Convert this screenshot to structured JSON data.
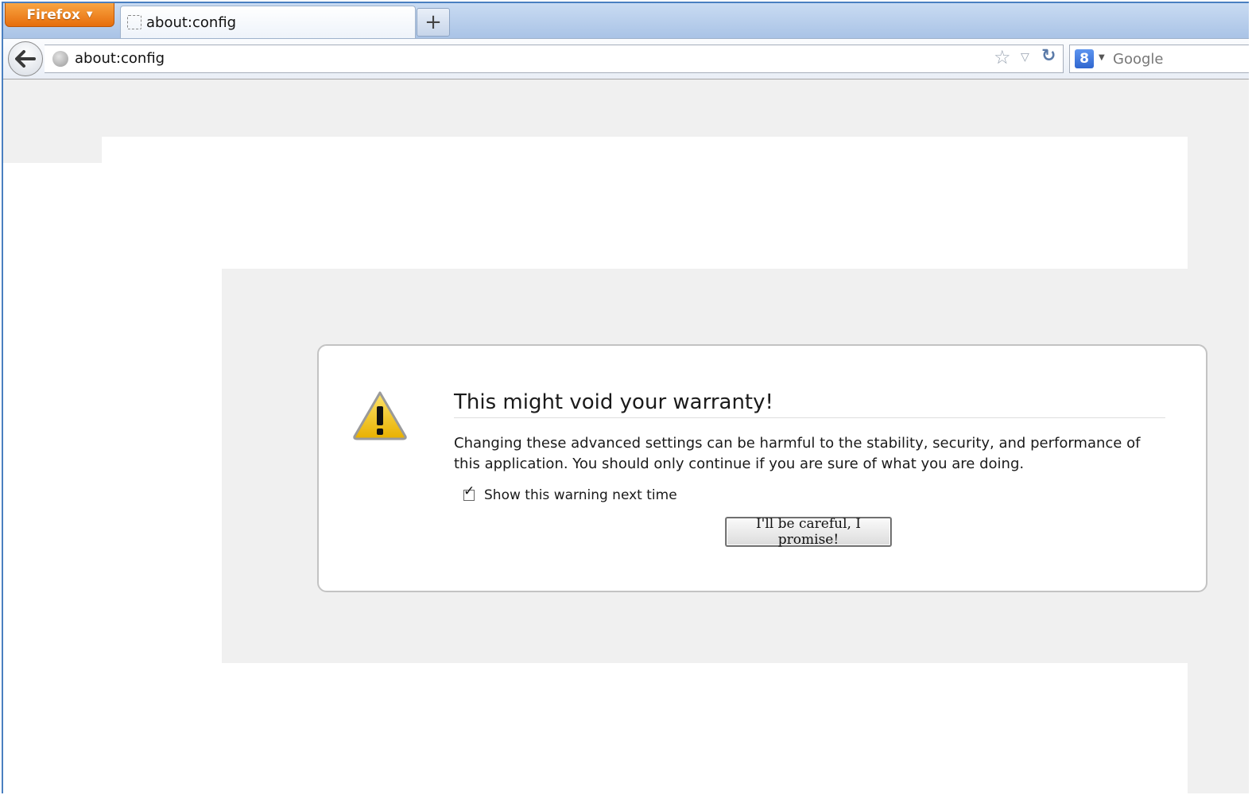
{
  "browser": {
    "app_button_label": "Firefox",
    "tab": {
      "title": "about:config"
    },
    "new_tab_label": "+",
    "url": "about:config",
    "search": {
      "engine": "8",
      "placeholder": "Google"
    }
  },
  "warning": {
    "title": "This might void your warranty!",
    "message": "Changing these advanced settings can be harmful to the stability, security, and performance of this application. You should only continue if you are sure of what you are doing.",
    "checkbox_label": "Show this warning next time",
    "checkbox_checked": true,
    "confirm_button": "I'll be careful, I promise!"
  },
  "colors": {
    "firefox_orange": "#e66d0c",
    "window_border": "#4a7fc0",
    "warning_yellow": "#f4c20d"
  },
  "icons": {
    "back": "back-arrow-icon",
    "site": "globe-icon",
    "bookmark": "star-icon",
    "history": "dropdown-arrow-icon",
    "reload": "reload-icon",
    "warning": "warning-triangle-icon"
  }
}
